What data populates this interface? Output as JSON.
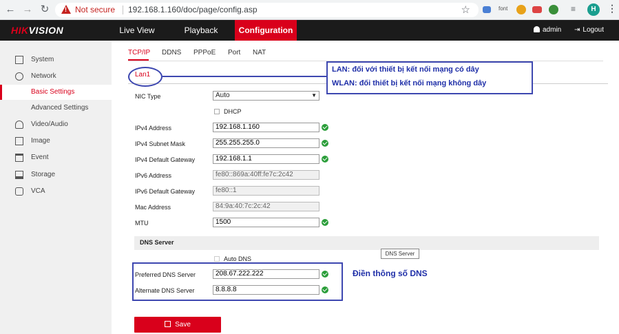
{
  "browser": {
    "not_secure": "Not secure",
    "url": "192.168.1.160/doc/page/config.asp",
    "ext_font": "font",
    "avatar_letter": "H"
  },
  "header": {
    "logo_main": "HIK",
    "logo_rest": "VISION",
    "nav": [
      "Live View",
      "Playback",
      "Configuration"
    ],
    "user": "admin",
    "logout": "Logout",
    "accent": "#d9001b"
  },
  "sidebar": {
    "items": [
      {
        "label": "System",
        "icon": "system-icon"
      },
      {
        "label": "Network",
        "icon": "globe-icon"
      },
      {
        "label": "Basic Settings",
        "icon": ""
      },
      {
        "label": "Advanced Settings",
        "icon": ""
      },
      {
        "label": "Video/Audio",
        "icon": "video-audio-icon"
      },
      {
        "label": "Image",
        "icon": "image-icon"
      },
      {
        "label": "Event",
        "icon": "calendar-icon"
      },
      {
        "label": "Storage",
        "icon": "storage-icon"
      },
      {
        "label": "VCA",
        "icon": "vca-icon"
      }
    ]
  },
  "tabs": [
    "TCP/IP",
    "DDNS",
    "PPPoE",
    "Port",
    "NAT"
  ],
  "lan_tab": "Lan1",
  "form": {
    "nic_type_label": "NIC Type",
    "nic_type_value": "Auto",
    "dhcp_label": "DHCP",
    "ipv4_address_label": "IPv4 Address",
    "ipv4_address": "192.168.1.160",
    "subnet_label": "IPv4 Subnet Mask",
    "subnet": "255.255.255.0",
    "gateway_label": "IPv4 Default Gateway",
    "gateway": "192.168.1.1",
    "ipv6_address_label": "IPv6 Address",
    "ipv6_address": "fe80::869a:40ff:fe7c:2c42",
    "ipv6_gateway_label": "IPv6 Default Gateway",
    "ipv6_gateway": "fe80::1",
    "mac_label": "Mac Address",
    "mac": "84:9a:40:7c:2c:42",
    "mtu_label": "MTU",
    "mtu": "1500",
    "dns_section": "DNS Server",
    "auto_dns_label": "Auto DNS",
    "preferred_dns_label": "Preferred DNS Server",
    "preferred_dns": "208.67.222.222",
    "alternate_dns_label": "Alternate DNS Server",
    "alternate_dns": "8.8.8.8",
    "tooltip": "DNS Server",
    "save": "Save"
  },
  "annotations": {
    "lan": "LAN: đối với thiết bị kết nối mạng có dây",
    "wlan": "WLAN: đối thiết bị kết nối mạng không dây",
    "dns_note": "Điền thông số DNS",
    "color": "#1f2fa8"
  }
}
